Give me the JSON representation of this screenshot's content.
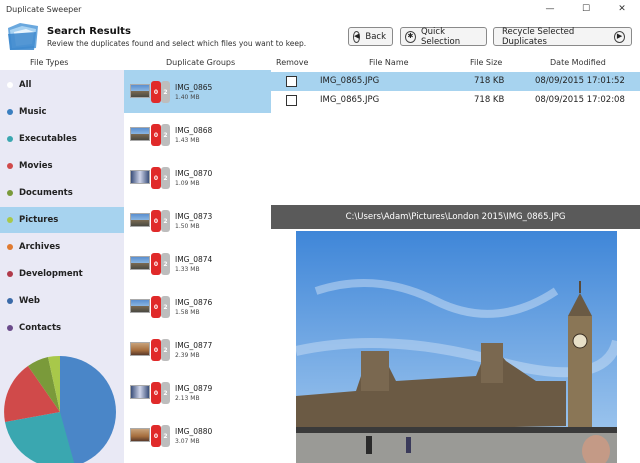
{
  "window": {
    "title": "Duplicate Sweeper",
    "controls": [
      "—",
      "☐",
      "✕"
    ]
  },
  "header": {
    "title": "Search Results",
    "subtitle": "Review the duplicates found and select which files you want to keep.",
    "back_label": "Back",
    "quick_label": "Quick Selection",
    "recycle_label": "Recycle Selected Duplicates"
  },
  "columns": {
    "file_types": "File Types",
    "duplicate_groups": "Duplicate Groups",
    "remove": "Remove",
    "file_name": "File Name",
    "file_size": "File Size",
    "date_modified": "Date Modified"
  },
  "file_types": [
    {
      "label": "All",
      "color": "#ffffff",
      "selected": false
    },
    {
      "label": "Music",
      "color": "#3a7fc0",
      "selected": false
    },
    {
      "label": "Executables",
      "color": "#3aa7b0",
      "selected": false
    },
    {
      "label": "Movies",
      "color": "#d04a4a",
      "selected": false
    },
    {
      "label": "Documents",
      "color": "#7a9a3a",
      "selected": false
    },
    {
      "label": "Pictures",
      "color": "#a8c84a",
      "selected": true
    },
    {
      "label": "Archives",
      "color": "#e07a30",
      "selected": false
    },
    {
      "label": "Development",
      "color": "#b03a4a",
      "selected": false
    },
    {
      "label": "Web",
      "color": "#3a6aa8",
      "selected": false
    },
    {
      "label": "Contacts",
      "color": "#6a4a8a",
      "selected": false
    }
  ],
  "pie_chart": {
    "colors": [
      "#4a86c8",
      "#3aa7b0",
      "#d04a4a",
      "#7a9a3a",
      "#a8c84a"
    ]
  },
  "groups": [
    {
      "name": "IMG_0865",
      "size": "1.40 MB",
      "removed": "0",
      "count": "2",
      "selected": true
    },
    {
      "name": "IMG_0868",
      "size": "1.43 MB",
      "removed": "0",
      "count": "2",
      "selected": false
    },
    {
      "name": "IMG_0870",
      "size": "1.09 MB",
      "removed": "0",
      "count": "2",
      "selected": false
    },
    {
      "name": "IMG_0873",
      "size": "1.50 MB",
      "removed": "0",
      "count": "2",
      "selected": false
    },
    {
      "name": "IMG_0874",
      "size": "1.33 MB",
      "removed": "0",
      "count": "2",
      "selected": false
    },
    {
      "name": "IMG_0876",
      "size": "1.58 MB",
      "removed": "0",
      "count": "2",
      "selected": false
    },
    {
      "name": "IMG_0877",
      "size": "2.39 MB",
      "removed": "0",
      "count": "2",
      "selected": false
    },
    {
      "name": "IMG_0879",
      "size": "2.13 MB",
      "removed": "0",
      "count": "2",
      "selected": false
    },
    {
      "name": "IMG_0880",
      "size": "3.07 MB",
      "removed": "0",
      "count": "2",
      "selected": false
    }
  ],
  "files": [
    {
      "name": "IMG_0865.JPG",
      "size": "718 KB",
      "date": "08/09/2015 17:01:52",
      "checked": false,
      "selected": true
    },
    {
      "name": "IMG_0865.JPG",
      "size": "718 KB",
      "date": "08/09/2015 17:02:08",
      "checked": false,
      "selected": false
    }
  ],
  "preview": {
    "path": "C:\\Users\\Adam\\Pictures\\London 2015\\IMG_0865.JPG"
  }
}
